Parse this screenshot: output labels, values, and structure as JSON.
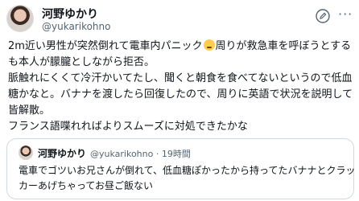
{
  "post": {
    "author_name": "河野ゆかり",
    "author_handle": "@yukarikohno",
    "body_lines": [
      "2m近い男性が突然倒れて電車内パニック",
      "周りが救急車を呼ぼうとする",
      "も本人が朦朧としながら拒否。",
      "脈触れにくくて冷汗かいてたし、聞くと朝食を食べてないというので低血",
      "糖かなと。バナナを渡したら回復したので、周りに英語で状況を説明して",
      "皆解散。",
      "フランス語喋れればよりスムーズに対処できたかな"
    ],
    "emoji": "face-emoji"
  },
  "quote": {
    "author_name": "河野ゆかり",
    "author_handle": "@yukarikohno",
    "separator": "·",
    "time": "19時間",
    "text_lines": [
      "電車でゴツいお兄さんが倒れて、低血糖ぽかったから持ってたバナナとクラッ",
      "カーあげちゃってお昼ご飯ない"
    ]
  },
  "icons": {
    "edit": "edit-icon",
    "more": "more-icon"
  }
}
